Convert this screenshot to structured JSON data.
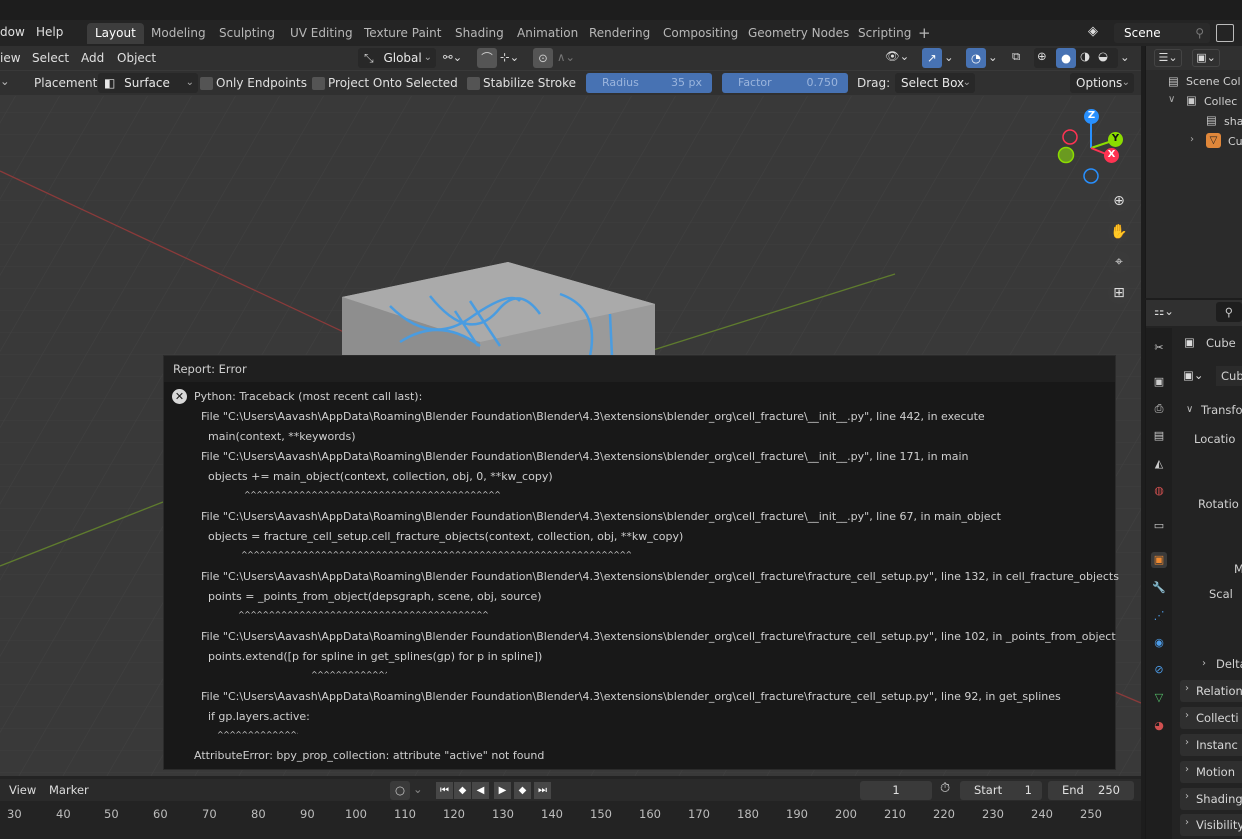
{
  "top_menu": {
    "window": "dow",
    "help": "Help"
  },
  "workspaces": [
    "Layout",
    "Modeling",
    "Sculpting",
    "UV Editing",
    "Texture Paint",
    "Shading",
    "Animation",
    "Rendering",
    "Compositing",
    "Geometry Nodes",
    "Scripting"
  ],
  "add_workspace": "+",
  "scene": {
    "name": "Scene"
  },
  "viewport_header": {
    "view": "iew",
    "select": "Select",
    "add": "Add",
    "object": "Object",
    "orientation": "Global"
  },
  "tool_settings": {
    "placement_label": "Placement:",
    "placement_value": "Surface",
    "only_endpoints": "Only Endpoints",
    "project_onto_selected": "Project Onto Selected",
    "stabilize_stroke": "Stabilize Stroke",
    "radius_label": "Radius",
    "radius_value": "35 px",
    "factor_label": "Factor",
    "factor_value": "0.750",
    "drag_label": "Drag:",
    "drag_value": "Select Box",
    "options": "Options"
  },
  "gizmo": {
    "z": "Z",
    "y": "Y",
    "x": "X"
  },
  "report": {
    "title": "Report: Error",
    "lines": [
      "Python: Traceback (most recent call last):",
      "  File \"C:\\Users\\Aavash\\AppData\\Roaming\\Blender Foundation\\Blender\\4.3\\extensions\\blender_org\\cell_fracture\\__init__.py\", line 442, in execute",
      "    main(context, **keywords)",
      "  File \"C:\\Users\\Aavash\\AppData\\Roaming\\Blender Foundation\\Blender\\4.3\\extensions\\blender_org\\cell_fracture\\__init__.py\", line 171, in main",
      "    objects += main_object(context, collection, obj, 0, **kw_copy)",
      "  File \"C:\\Users\\Aavash\\AppData\\Roaming\\Blender Foundation\\Blender\\4.3\\extensions\\blender_org\\cell_fracture\\__init__.py\", line 67, in main_object",
      "    objects = fracture_cell_setup.cell_fracture_objects(context, collection, obj, **kw_copy)",
      "  File \"C:\\Users\\Aavash\\AppData\\Roaming\\Blender Foundation\\Blender\\4.3\\extensions\\blender_org\\cell_fracture\\fracture_cell_setup.py\", line 132, in cell_fracture_objects",
      "    points = _points_from_object(depsgraph, scene, obj, source)",
      "  File \"C:\\Users\\Aavash\\AppData\\Roaming\\Blender Foundation\\Blender\\4.3\\extensions\\blender_org\\cell_fracture\\fracture_cell_setup.py\", line 102, in _points_from_object",
      "    points.extend([p for spline in get_splines(gp) for p in spline])",
      "  File \"C:\\Users\\Aavash\\AppData\\Roaming\\Blender Foundation\\Blender\\4.3\\extensions\\blender_org\\cell_fracture\\fracture_cell_setup.py\", line 92, in get_splines",
      "    if gp.layers.active:",
      "AttributeError: bpy_prop_collection: attribute \"active\" not found"
    ]
  },
  "timeline": {
    "view": "View",
    "marker": "Marker",
    "current_frame": "1",
    "start_label": "Start",
    "start_value": "1",
    "end_label": "End",
    "end_value": "250",
    "ruler": [
      "30",
      "40",
      "50",
      "60",
      "70",
      "80",
      "90",
      "100",
      "110",
      "120",
      "130",
      "140",
      "150",
      "160",
      "170",
      "180",
      "190",
      "200",
      "210",
      "220",
      "230",
      "240",
      "250"
    ]
  },
  "outliner": {
    "items": [
      "Scene Col",
      "Collec",
      "sha",
      "Cu"
    ]
  },
  "properties": {
    "object_name": "Cube",
    "object_field": "Cub",
    "transform": "Transfo",
    "location": "Locatio",
    "rotation": "Rotatio",
    "mode": "M",
    "scale": "Scal",
    "delta": "Delta",
    "sections": [
      "Relation",
      "Collecti",
      "Instanc",
      "Motion",
      "Shading",
      "Visibility"
    ]
  },
  "colors": {
    "accent": "#4772b3",
    "x_axis": "#ff3352",
    "y_axis": "#8bdc00",
    "z_axis": "#2890ff"
  }
}
